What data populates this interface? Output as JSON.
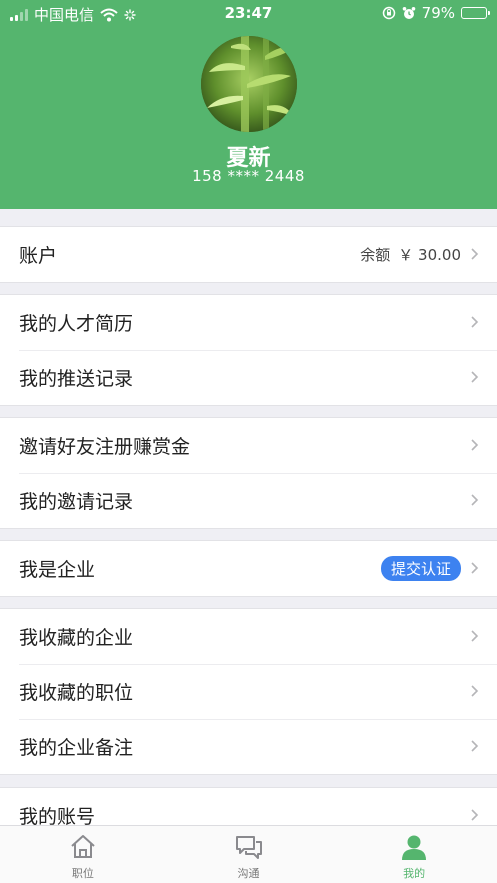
{
  "status_bar": {
    "carrier": "中国电信",
    "time": "23:47",
    "battery_percent": "79%",
    "battery_level": 0.79
  },
  "profile": {
    "name": "夏新",
    "phone": "158 **** 2448"
  },
  "account": {
    "label": "账户",
    "balance_label": "余额",
    "balance_value": "￥ 30.00"
  },
  "menu": {
    "resume": "我的人才简历",
    "push_records": "我的推送记录",
    "invite_friends": "邀请好友注册赚赏金",
    "invite_records": "我的邀请记录",
    "i_am_company": "我是企业",
    "submit_cert": "提交认证",
    "fav_companies": "我收藏的企业",
    "fav_jobs": "我收藏的职位",
    "company_notes": "我的企业备注",
    "my_account": "我的账号"
  },
  "tabs": {
    "jobs": "职位",
    "chat": "沟通",
    "mine": "我的"
  },
  "colors": {
    "brand_green": "#55b56e",
    "badge_blue": "#3d82f0"
  }
}
